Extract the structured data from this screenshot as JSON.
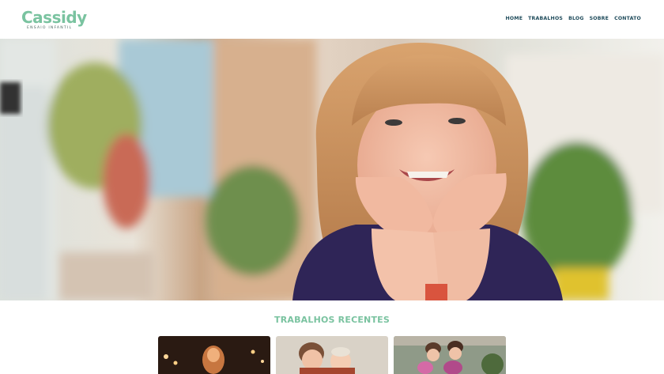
{
  "brand": {
    "name": "Cassidy",
    "tagline": "ENSAIO INFANTIL"
  },
  "nav": [
    {
      "label": "HOME"
    },
    {
      "label": "TRABALHOS"
    },
    {
      "label": "BLOG"
    },
    {
      "label": "SOBRE"
    },
    {
      "label": "CONTATO"
    }
  ],
  "recent": {
    "title": "TRABALHOS RECENTES"
  },
  "colors": {
    "brand": "#7ac3a0",
    "nav": "#1f4b5b",
    "background": "#ffffff"
  }
}
